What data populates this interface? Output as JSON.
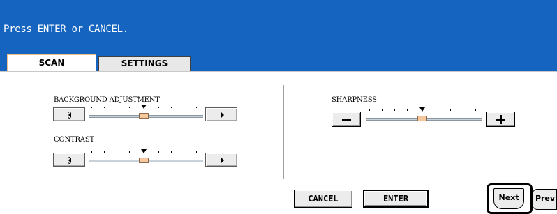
{
  "message": "Press ENTER or CANCEL.",
  "tabs": [
    {
      "label": "SCAN",
      "selected": true
    },
    {
      "label": "SETTINGS",
      "selected": false
    }
  ],
  "settings": {
    "background_adjustment": {
      "label": "BACKGROUND ADJUSTMENT",
      "level": 0
    },
    "contrast": {
      "label": "CONTRAST",
      "level": 0
    },
    "sharpness": {
      "label": "SHARPNESS",
      "level": 0
    }
  },
  "actions": {
    "cancel": "CANCEL",
    "enter": "ENTER"
  },
  "paging": {
    "next": "Next",
    "prev": "Prev"
  },
  "colors": {
    "header_blue": "#1565c0",
    "slider_knob": "#f4c79c",
    "tab_accent": "#f0c08a"
  }
}
